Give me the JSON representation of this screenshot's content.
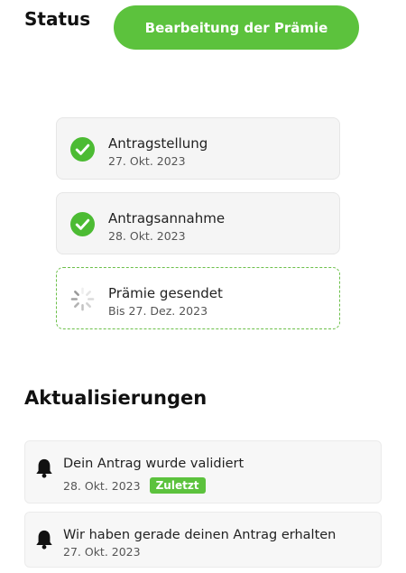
{
  "header": {
    "title": "Status",
    "status_pill": "Bearbeitung der Prämie"
  },
  "steps": [
    {
      "label": "Antragstellung",
      "date": "27. Okt. 2023",
      "state": "done"
    },
    {
      "label": "Antragsannahme",
      "date": "28. Okt. 2023",
      "state": "done"
    },
    {
      "label": "Prämie gesendet",
      "date": "Bis 27. Dez. 2023",
      "state": "pending"
    }
  ],
  "updates": {
    "title": "Aktualisierungen",
    "items": [
      {
        "text": "Dein Antrag wurde validiert",
        "date": "28. Okt. 2023",
        "badge": "Zuletzt"
      },
      {
        "text": "Wir haben gerade deinen Antrag erhalten",
        "date": "27. Okt. 2023"
      }
    ]
  },
  "colors": {
    "accent": "#5cc23d",
    "check": "#4cbb33",
    "pending_border": "#6cc04a",
    "spinner": "#9a9a9a"
  },
  "icons": {
    "done": "check-circle-icon",
    "pending": "loading-spinner-icon",
    "update": "bell-icon"
  }
}
